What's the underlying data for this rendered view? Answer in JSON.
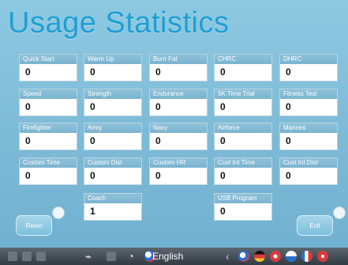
{
  "title": "Usage Statistics",
  "tiles": [
    {
      "label": "Quick Start",
      "value": "0"
    },
    {
      "label": "Warm Up",
      "value": "0"
    },
    {
      "label": "Burn Fat",
      "value": "0"
    },
    {
      "label": "CHRC",
      "value": "0"
    },
    {
      "label": "DHRC",
      "value": "0"
    },
    {
      "label": "Speed",
      "value": "0"
    },
    {
      "label": "Strength",
      "value": "0"
    },
    {
      "label": "Endurance",
      "value": "0"
    },
    {
      "label": "5K Time Trial",
      "value": "0"
    },
    {
      "label": "Fitness Test",
      "value": "0"
    },
    {
      "label": "Firefighter",
      "value": "0"
    },
    {
      "label": "Army",
      "value": "0"
    },
    {
      "label": "Navy",
      "value": "0"
    },
    {
      "label": "Airforce",
      "value": "0"
    },
    {
      "label": "Marines",
      "value": "0"
    },
    {
      "label": "Custom Time",
      "value": "0"
    },
    {
      "label": "Custom Dist",
      "value": "0"
    },
    {
      "label": "Custom HR",
      "value": "0"
    },
    {
      "label": "Cust Int Time",
      "value": "0"
    },
    {
      "label": "Cust Int Dist",
      "value": "0"
    },
    {
      "label": "Coach",
      "value": "1"
    },
    {
      "label": "USB Program",
      "value": "0"
    }
  ],
  "buttons": {
    "reset": "Reset",
    "exit": "Exit"
  },
  "bottom_bar": {
    "language": "English",
    "icons": [
      "bar-square-icon",
      "bar-square-icon",
      "bar-square-icon",
      "tool-icon",
      "bar-square-icon",
      "speaker-icon"
    ]
  },
  "colors": {
    "title": "#1f9fd4",
    "tile_label_bg": "#7ab3cf",
    "background": "#7fbcd8"
  }
}
